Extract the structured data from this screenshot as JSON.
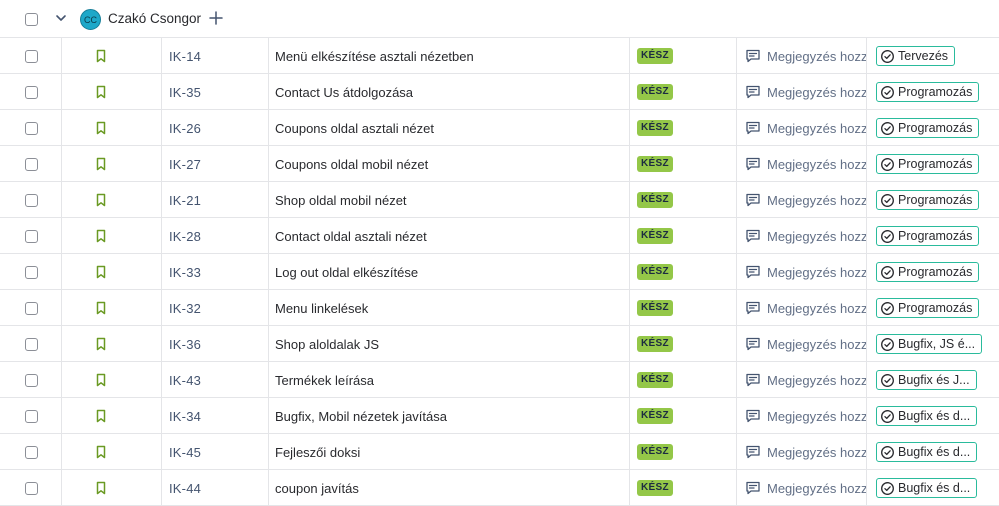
{
  "group": {
    "avatar_initials": "CC",
    "name": "Czakó Csongor",
    "avatar_color": "#1ea8c9"
  },
  "colors": {
    "status_done": "#94c748",
    "story_icon": "#6a9a23",
    "sprint_border": "#2abb9c"
  },
  "rows": [
    {
      "key": "IK-14",
      "summary": "Menü elkészítése asztali nézetben",
      "status": "KÉSZ",
      "comment": "Megjegyzés hozzáadása",
      "sprint": "Tervezés"
    },
    {
      "key": "IK-35",
      "summary": "Contact Us átdolgozása",
      "status": "KÉSZ",
      "comment": "Megjegyzés hozzáadása",
      "sprint": "Programozás"
    },
    {
      "key": "IK-26",
      "summary": "Coupons oldal asztali nézet",
      "status": "KÉSZ",
      "comment": "Megjegyzés hozzáadása",
      "sprint": "Programozás"
    },
    {
      "key": "IK-27",
      "summary": "Coupons oldal mobil nézet",
      "status": "KÉSZ",
      "comment": "Megjegyzés hozzáadása",
      "sprint": "Programozás"
    },
    {
      "key": "IK-21",
      "summary": "Shop oldal mobil nézet",
      "status": "KÉSZ",
      "comment": "Megjegyzés hozzáadása",
      "sprint": "Programozás"
    },
    {
      "key": "IK-28",
      "summary": "Contact oldal asztali nézet",
      "status": "KÉSZ",
      "comment": "Megjegyzés hozzáadása",
      "sprint": "Programozás"
    },
    {
      "key": "IK-33",
      "summary": "Log out oldal elkészítése",
      "status": "KÉSZ",
      "comment": "Megjegyzés hozzáadása",
      "sprint": "Programozás"
    },
    {
      "key": "IK-32",
      "summary": "Menu linkelések",
      "status": "KÉSZ",
      "comment": "Megjegyzés hozzáadása",
      "sprint": "Programozás"
    },
    {
      "key": "IK-36",
      "summary": "Shop aloldalak JS",
      "status": "KÉSZ",
      "comment": "Megjegyzés hozzáadása",
      "sprint": "Bugfix, JS é..."
    },
    {
      "key": "IK-43",
      "summary": "Termékek leírása",
      "status": "KÉSZ",
      "comment": "Megjegyzés hozzáadása",
      "sprint": "Bugfix és J..."
    },
    {
      "key": "IK-34",
      "summary": "Bugfix, Mobil nézetek javítása",
      "status": "KÉSZ",
      "comment": "Megjegyzés hozzáadása",
      "sprint": "Bugfix és d..."
    },
    {
      "key": "IK-45",
      "summary": "Fejleszői doksi",
      "status": "KÉSZ",
      "comment": "Megjegyzés hozzáadása",
      "sprint": "Bugfix és d..."
    },
    {
      "key": "IK-44",
      "summary": "coupon javítás",
      "status": "KÉSZ",
      "comment": "Megjegyzés hozzáadása",
      "sprint": "Bugfix és d..."
    }
  ]
}
